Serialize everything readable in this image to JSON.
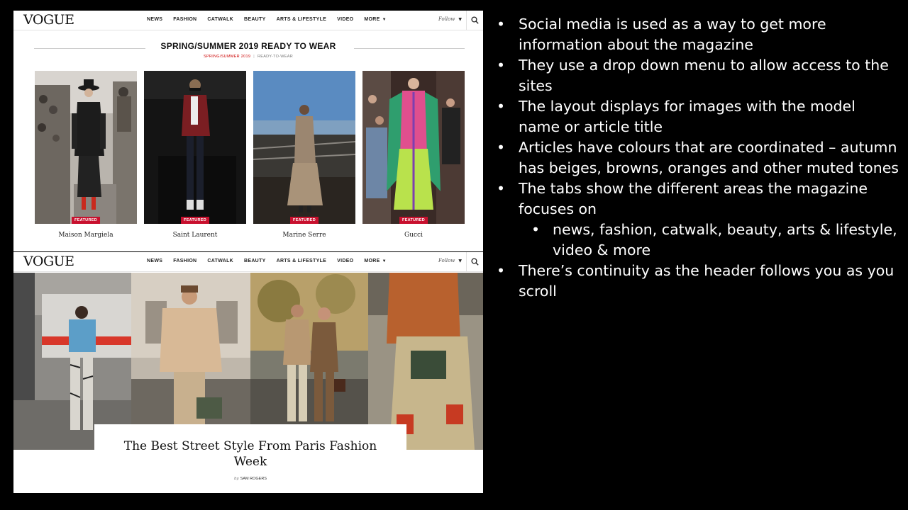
{
  "vogue_header": {
    "logo": "VOGUE",
    "nav": [
      "NEWS",
      "FASHION",
      "CATWALK",
      "BEAUTY",
      "ARTS & LIFESTYLE",
      "VIDEO",
      "MORE"
    ],
    "follow": "Follow",
    "icons": {
      "search": "search-icon",
      "caret": "chevron-down-icon"
    }
  },
  "collection": {
    "title": "SPRING/SUMMER 2019 READY TO WEAR",
    "breadcrumb_active": "SPRING/SUMMER 2019",
    "breadcrumb_other": "READY-TO-WEAR",
    "badge": "FEATURED",
    "cards": [
      {
        "name": "Maison Margiela"
      },
      {
        "name": "Saint Laurent"
      },
      {
        "name": "Marine Serre"
      },
      {
        "name": "Gucci"
      }
    ]
  },
  "article": {
    "title": "The Best Street Style From Paris Fashion Week",
    "byline_prefix": "by",
    "author": "SAM ROGERS"
  },
  "notes": {
    "bullets": [
      "Social media is used as a way to get more information about the magazine",
      "They use a drop down menu to allow access to the sites",
      "The layout displays for images with the model name or article title",
      "Articles have colours that are coordinated – autumn has beiges, browns, oranges and other muted tones",
      "The tabs show the different areas the magazine focuses on"
    ],
    "sub_bullet": "news, fashion, catwalk, beauty, arts & lifestyle, video & more",
    "last_bullet": "There’s continuity as the header follows you as you scroll"
  },
  "colors": {
    "accent_red": "#c8102e",
    "background": "#000000",
    "text": "#ffffff"
  }
}
